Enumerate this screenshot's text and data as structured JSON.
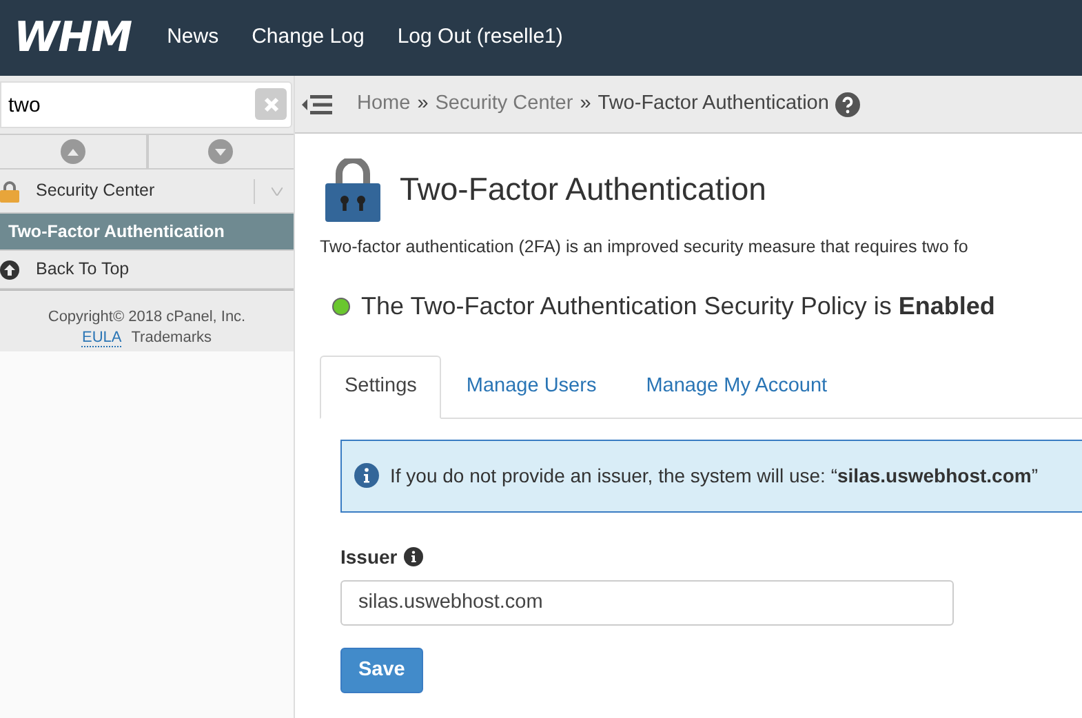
{
  "header": {
    "logo": "WHM",
    "nav": [
      {
        "label": "News"
      },
      {
        "label": "Change Log"
      },
      {
        "label": "Log Out (reselle1)"
      }
    ]
  },
  "sidebar": {
    "search": {
      "value": "two"
    },
    "items": [
      {
        "kind": "category",
        "label": "Security Center",
        "selected": false
      },
      {
        "kind": "link",
        "label": "Two-Factor Authentication",
        "selected": true
      },
      {
        "kind": "back",
        "label": "Back To Top",
        "selected": false
      }
    ],
    "footer": {
      "copyright": "Copyright© 2018",
      "company": "cPanel, Inc.",
      "links": [
        "EULA",
        "Trademarks"
      ]
    }
  },
  "breadcrumb": [
    {
      "label": "Home",
      "separator": "»"
    },
    {
      "label": "Security Center",
      "separator": "»"
    },
    {
      "label": "Two-Factor Authentication"
    }
  ],
  "page": {
    "title": "Two-Factor Authentication",
    "description": "Two-factor authentication (2FA) is an improved security measure that requires two fo",
    "policy": {
      "enabled": true,
      "text": "The Two-Factor Authentication Security Policy is **Enabled**"
    },
    "tabs": [
      {
        "label": "Settings",
        "selected": true
      },
      {
        "label": "Manage Users",
        "selected": false
      },
      {
        "label": "Manage My Account",
        "selected": false
      }
    ],
    "alert": "If you do not provide an issuer, the system will use: “**silas.uswebhost.com**”",
    "issuer": {
      "label": "Issuer",
      "value": "silas.uswebhost.com"
    },
    "save": "Save"
  }
}
